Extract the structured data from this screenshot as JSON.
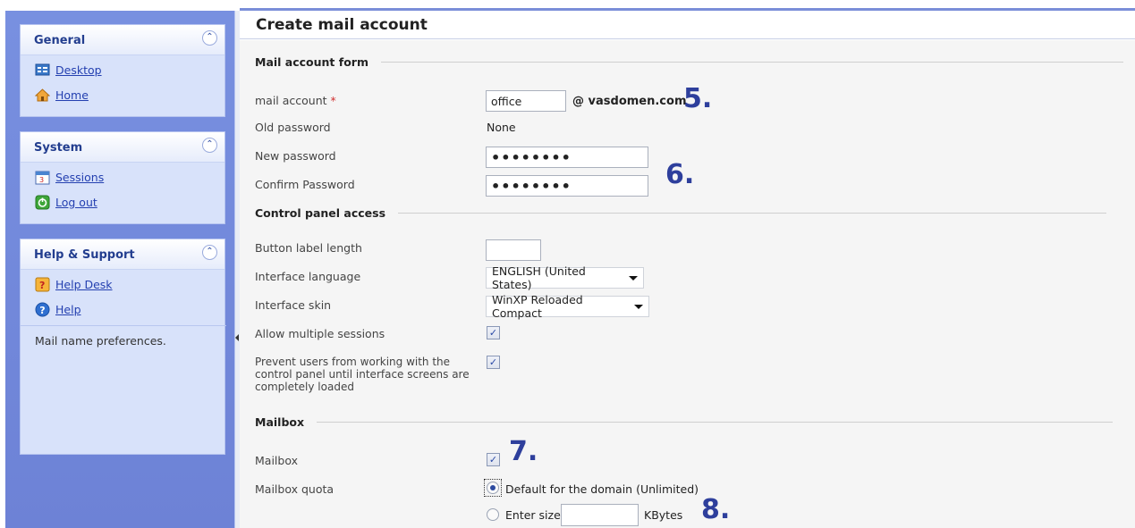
{
  "sidebar": {
    "general": {
      "title": "General",
      "items": [
        {
          "label": "Desktop",
          "icon": "desktop-icon"
        },
        {
          "label": "Home",
          "icon": "home-icon"
        }
      ]
    },
    "system": {
      "title": "System",
      "items": [
        {
          "label": "Sessions",
          "icon": "calendar-icon"
        },
        {
          "label": "Log out",
          "icon": "logout-icon"
        }
      ]
    },
    "help": {
      "title": "Help & Support",
      "items": [
        {
          "label": "Help Desk",
          "icon": "helpdesk-icon"
        },
        {
          "label": "Help",
          "icon": "question-icon"
        }
      ],
      "text": "Mail name preferences."
    }
  },
  "main": {
    "title": "Create mail account",
    "sections": {
      "mail_account_form": "Mail account form",
      "control_panel_access": "Control panel access",
      "mailbox": "Mailbox"
    },
    "fields": {
      "mail_account": {
        "label": "mail account",
        "required_mark": "*",
        "value": "office",
        "domain": "@ vasdomen.com"
      },
      "old_password": {
        "label": "Old password",
        "value": "None"
      },
      "new_password": {
        "label": "New password",
        "value": "••••••••"
      },
      "confirm_password": {
        "label": "Confirm Password",
        "value": "••••••••"
      },
      "button_label_length": {
        "label": "Button label length",
        "value": ""
      },
      "interface_language": {
        "label": "Interface language",
        "value": "ENGLISH (United States)"
      },
      "interface_skin": {
        "label": "Interface skin",
        "value": "WinXP Reloaded Compact"
      },
      "allow_multiple_sessions": {
        "label": "Allow multiple sessions",
        "checked": true
      },
      "prevent_users": {
        "label_lines": [
          "Prevent users from working with the",
          "control panel until interface screens are",
          "completely loaded"
        ],
        "checked": true
      },
      "mailbox": {
        "label": "Mailbox",
        "checked": true
      },
      "mailbox_quota": {
        "label": "Mailbox quota",
        "option_default": "Default for the domain (Unlimited)",
        "option_size": "Enter size",
        "size_value": "",
        "unit": "KBytes",
        "selected": "default"
      }
    },
    "annotations": {
      "step5": "5.",
      "step6": "6.",
      "step7": "7.",
      "step8": "8."
    }
  },
  "colors": {
    "sidebar_bg": "#7088dc",
    "panel_bg": "#d8e2fa",
    "link": "#2440b0",
    "annotation": "#2e3f9c",
    "required": "#d03030"
  }
}
